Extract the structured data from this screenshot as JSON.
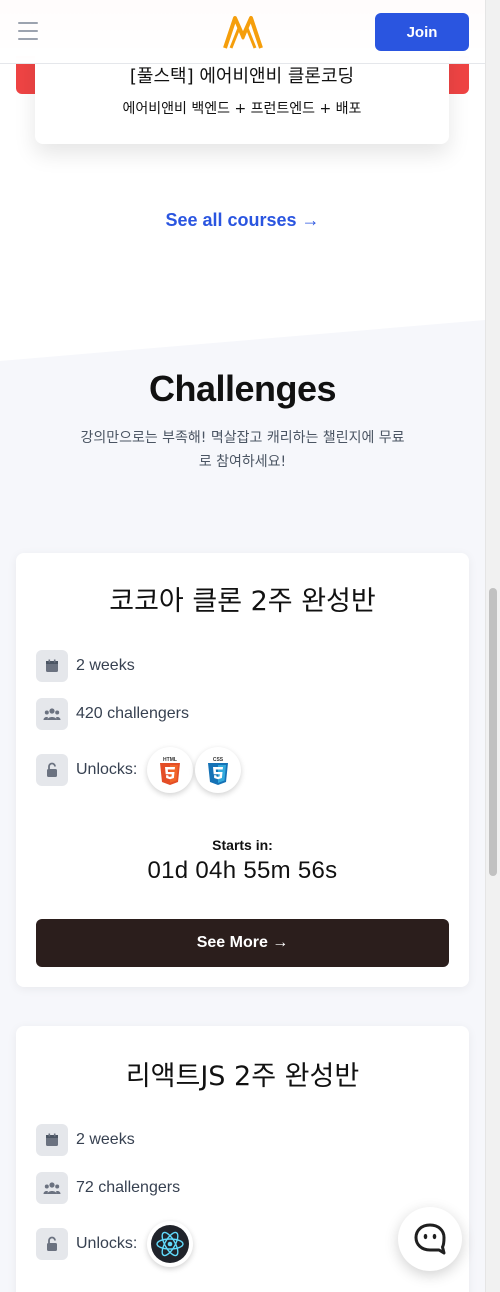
{
  "header": {
    "join_label": "Join"
  },
  "course": {
    "title": "[풀스택] 에어비앤비 클론코딩",
    "subtitle": "에어비앤비 백엔드 + 프런트엔드 + 배포"
  },
  "see_all_label": "See all courses →",
  "challenges": {
    "title": "Challenges",
    "description": "강의만으로는 부족해! 멱살잡고 캐리하는 챌린지에 무료로 참여하세요!",
    "unlocks_label": "Unlocks:",
    "starts_label": "Starts in:",
    "see_more_label": "See More →",
    "items": [
      {
        "title": "코코아 클론 2주 완성반",
        "duration": "2 weeks",
        "challengers": "420 challengers",
        "unlocks": [
          "html5-icon",
          "css3-icon"
        ],
        "countdown": "01d 04h 55m 56s"
      },
      {
        "title": "리액트JS 2주 완성반",
        "duration": "2 weeks",
        "challengers": "72 challengers",
        "unlocks": [
          "react-icon"
        ]
      }
    ]
  },
  "colors": {
    "accent": "#2a55e0",
    "course_accent": "#ef4444",
    "button_dark": "#2b1e1c",
    "logo": "#f59e0b"
  }
}
